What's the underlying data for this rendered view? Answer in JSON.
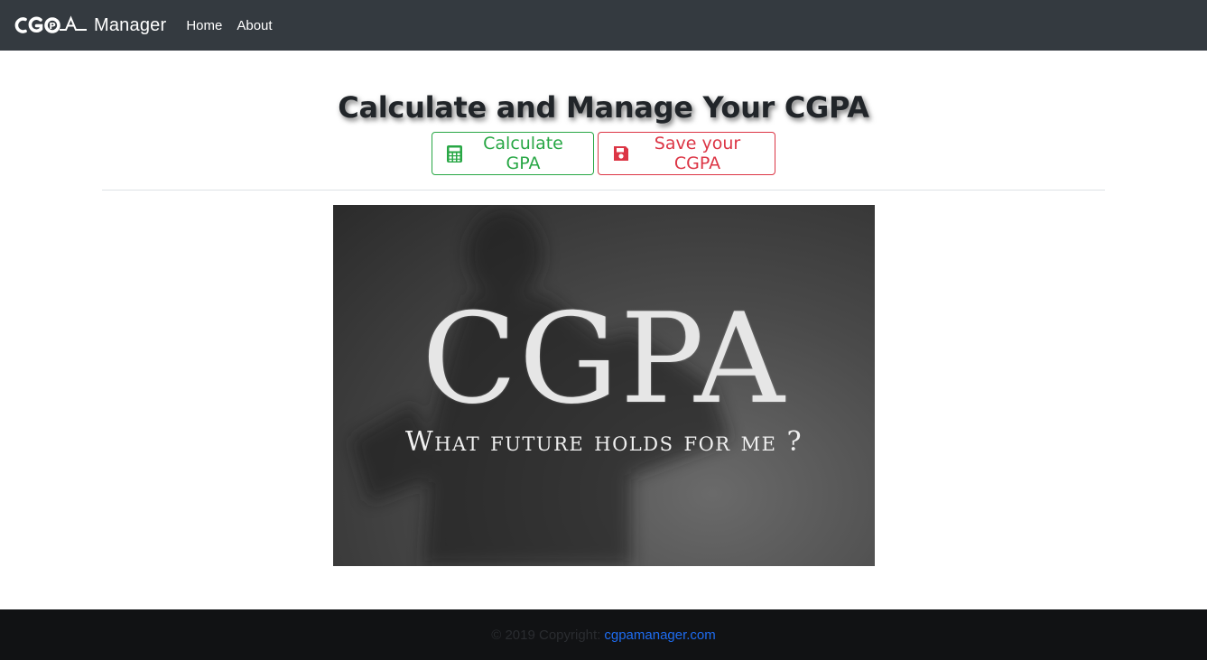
{
  "navbar": {
    "logo_text": "CGPA",
    "brand_text": "Manager",
    "links": [
      "Home",
      "About"
    ]
  },
  "main": {
    "title": "Calculate and Manage Your CGPA",
    "buttons": {
      "calculate": {
        "label": "Calculate GPA",
        "icon": "calculator-icon",
        "color": "#28a745"
      },
      "save": {
        "label": "Save your CGPA",
        "icon": "floppy-disk-icon",
        "color": "#dc3545"
      }
    },
    "hero": {
      "title": "CGPA",
      "subtitle": "What future holds for me ?"
    }
  },
  "footer": {
    "copyright": "© 2019 Copyright:",
    "link": "cgpamanager.com"
  },
  "colors": {
    "navbar_bg": "#343a40",
    "footer_bg": "#111214",
    "link": "#1e6cf0"
  }
}
